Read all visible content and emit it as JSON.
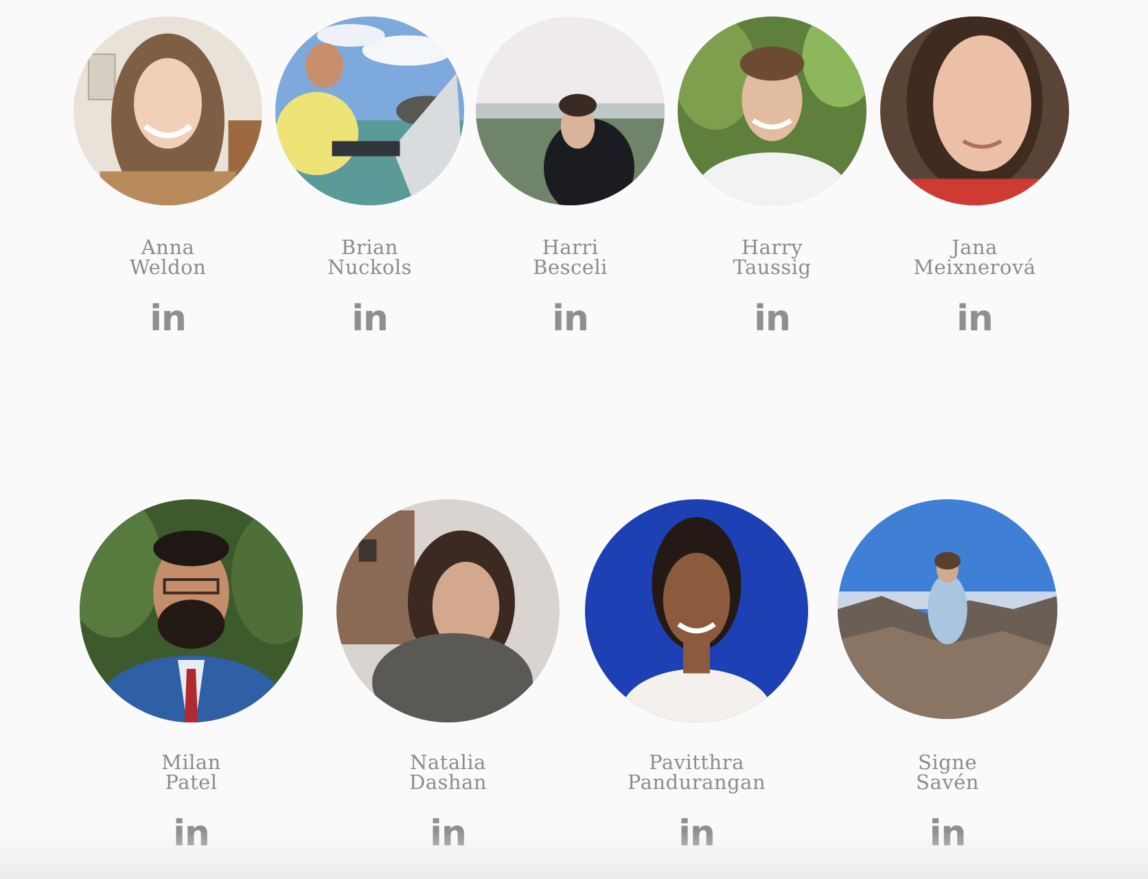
{
  "team": {
    "row1": [
      {
        "first": "Anna",
        "last": "Weldon",
        "link_icon": "linkedin-icon",
        "link_label": "in",
        "photo_colors": [
          "#e8e0d6",
          "#9a7a5c",
          "#f3d7c4"
        ]
      },
      {
        "first": "Brian",
        "last": "Nuckols",
        "link_icon": "linkedin-icon",
        "link_label": "in",
        "photo_colors": [
          "#6d9fd6",
          "#e9e46f",
          "#4e8c8c"
        ]
      },
      {
        "first": "Harri",
        "last": "Besceli",
        "link_icon": "linkedin-icon",
        "link_label": "in",
        "photo_colors": [
          "#eeeaea",
          "#6f7f66",
          "#1c1d22"
        ]
      },
      {
        "first": "Harry",
        "last": "Taussig",
        "link_icon": "linkedin-icon",
        "link_label": "in",
        "photo_colors": [
          "#5c7a3c",
          "#d8b79a",
          "#f4f4f4"
        ]
      },
      {
        "first": "Jana",
        "last": "Meixnerová",
        "link_icon": "linkedin-icon",
        "link_label": "in",
        "photo_colors": [
          "#4a3428",
          "#e6b9a2",
          "#d2372f"
        ]
      }
    ],
    "row2": [
      {
        "first": "Milan",
        "last": "Patel",
        "link_icon": "linkedin-icon",
        "link_label": "in",
        "photo_colors": [
          "#3c5a2c",
          "#2f5fa5",
          "#c7906d"
        ]
      },
      {
        "first": "Natalia",
        "last": "Dashan",
        "link_icon": "linkedin-icon",
        "link_label": "in",
        "photo_colors": [
          "#c9c4c0",
          "#5c5a58",
          "#c89f86"
        ]
      },
      {
        "first": "Pavitthra",
        "last": "Pandurangan",
        "link_icon": "linkedin-icon",
        "link_label": "in",
        "photo_colors": [
          "#1f43b6",
          "#8b5a3c",
          "#f4f1ec"
        ]
      },
      {
        "first": "Signe",
        "last": "Savén",
        "link_icon": "linkedin-icon",
        "link_label": "in",
        "photo_colors": [
          "#3f7fd6",
          "#8a7766",
          "#cfdceb"
        ]
      }
    ]
  }
}
